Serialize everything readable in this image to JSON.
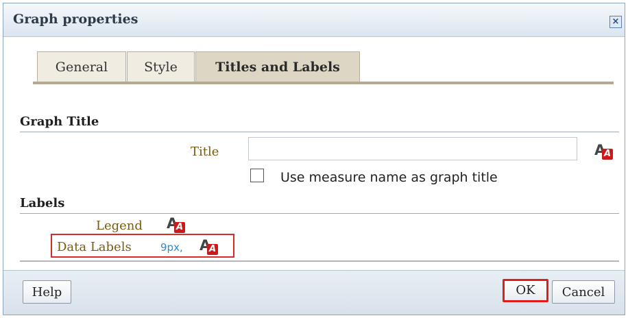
{
  "dialog": {
    "title": "Graph properties",
    "tabs": [
      "General",
      "Style",
      "Titles and Labels"
    ]
  },
  "sections": {
    "graph_title": "Graph Title",
    "labels": "Labels"
  },
  "fields": {
    "title_label": "Title",
    "title_value": "",
    "checkbox_label": "Use measure name as graph title",
    "legend_label": "Legend",
    "data_labels_label": "Data Labels",
    "data_labels_value": "9px,"
  },
  "buttons": {
    "help": "Help",
    "ok": "OK",
    "cancel": "Cancel"
  },
  "icons": {
    "format": "text-format-icon",
    "close": "close-icon"
  }
}
